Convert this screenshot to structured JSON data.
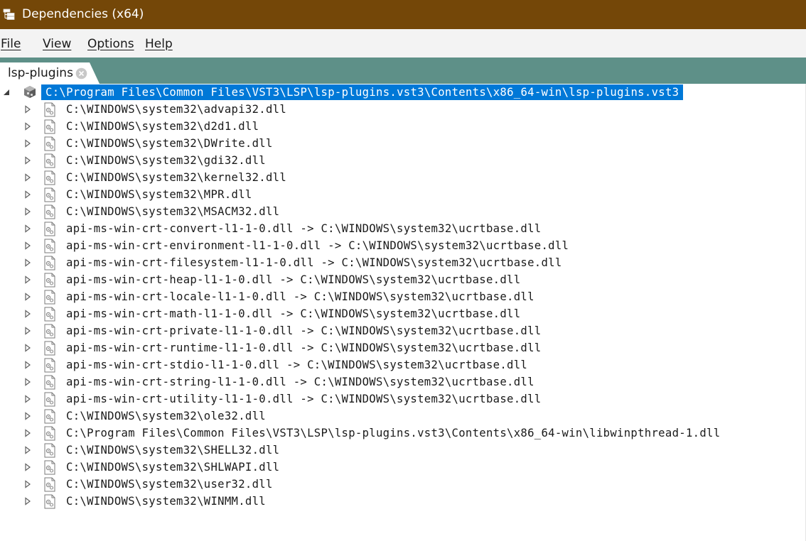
{
  "window": {
    "title": "Dependencies (x64)",
    "icon": "app-tree-icon",
    "titlebar_color": "#744708"
  },
  "menu": [
    {
      "label": "File"
    },
    {
      "label": "View"
    },
    {
      "label": "Options"
    },
    {
      "label": "Help"
    }
  ],
  "tabs": [
    {
      "label": "lsp-plugins",
      "close_icon": "close-circle-icon"
    }
  ],
  "tree": {
    "root": {
      "label": "C:\\Program Files\\Common Files\\VST3\\LSP\\lsp-plugins.vst3\\Contents\\x86_64-win\\lsp-plugins.vst3",
      "expanded": true,
      "selected": true,
      "icon": "module-root-icon"
    },
    "children": [
      {
        "label": "C:\\WINDOWS\\system32\\advapi32.dll"
      },
      {
        "label": "C:\\WINDOWS\\system32\\d2d1.dll"
      },
      {
        "label": "C:\\WINDOWS\\system32\\DWrite.dll"
      },
      {
        "label": "C:\\WINDOWS\\system32\\gdi32.dll"
      },
      {
        "label": "C:\\WINDOWS\\system32\\kernel32.dll"
      },
      {
        "label": "C:\\WINDOWS\\system32\\MPR.dll"
      },
      {
        "label": "C:\\WINDOWS\\system32\\MSACM32.dll"
      },
      {
        "label": "api-ms-win-crt-convert-l1-1-0.dll -> C:\\WINDOWS\\system32\\ucrtbase.dll"
      },
      {
        "label": "api-ms-win-crt-environment-l1-1-0.dll -> C:\\WINDOWS\\system32\\ucrtbase.dll"
      },
      {
        "label": "api-ms-win-crt-filesystem-l1-1-0.dll -> C:\\WINDOWS\\system32\\ucrtbase.dll"
      },
      {
        "label": "api-ms-win-crt-heap-l1-1-0.dll -> C:\\WINDOWS\\system32\\ucrtbase.dll"
      },
      {
        "label": "api-ms-win-crt-locale-l1-1-0.dll -> C:\\WINDOWS\\system32\\ucrtbase.dll"
      },
      {
        "label": "api-ms-win-crt-math-l1-1-0.dll -> C:\\WINDOWS\\system32\\ucrtbase.dll"
      },
      {
        "label": "api-ms-win-crt-private-l1-1-0.dll -> C:\\WINDOWS\\system32\\ucrtbase.dll"
      },
      {
        "label": "api-ms-win-crt-runtime-l1-1-0.dll -> C:\\WINDOWS\\system32\\ucrtbase.dll"
      },
      {
        "label": "api-ms-win-crt-stdio-l1-1-0.dll -> C:\\WINDOWS\\system32\\ucrtbase.dll"
      },
      {
        "label": "api-ms-win-crt-string-l1-1-0.dll -> C:\\WINDOWS\\system32\\ucrtbase.dll"
      },
      {
        "label": "api-ms-win-crt-utility-l1-1-0.dll -> C:\\WINDOWS\\system32\\ucrtbase.dll"
      },
      {
        "label": "C:\\WINDOWS\\system32\\ole32.dll"
      },
      {
        "label": "C:\\Program Files\\Common Files\\VST3\\LSP\\lsp-plugins.vst3\\Contents\\x86_64-win\\libwinpthread-1.dll"
      },
      {
        "label": "C:\\WINDOWS\\system32\\SHELL32.dll"
      },
      {
        "label": "C:\\WINDOWS\\system32\\SHLWAPI.dll"
      },
      {
        "label": "C:\\WINDOWS\\system32\\user32.dll"
      },
      {
        "label": "C:\\WINDOWS\\system32\\WINMM.dll"
      }
    ]
  },
  "colors": {
    "tabstrip": "#5e9088",
    "selection": "#0078d7",
    "menubar": "#f3f3f3"
  }
}
